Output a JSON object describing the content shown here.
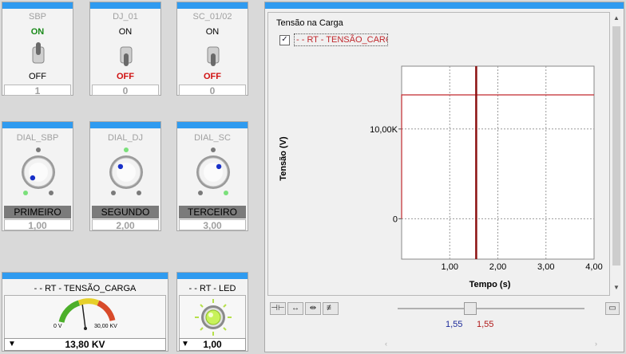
{
  "switches": [
    {
      "title": "SBP",
      "on": "ON",
      "off": "OFF",
      "value": "1",
      "active": "on"
    },
    {
      "title": "DJ_01",
      "on": "ON",
      "off": "OFF",
      "value": "0",
      "active": "off"
    },
    {
      "title": "SC_01/02",
      "on": "ON",
      "off": "OFF",
      "value": "0",
      "active": "off"
    }
  ],
  "dials": [
    {
      "title": "DIAL_SBP",
      "position": "PRIMEIRO",
      "value": "1,00"
    },
    {
      "title": "DIAL_DJ",
      "position": "SEGUNDO",
      "value": "2,00"
    },
    {
      "title": "DIAL_SC",
      "position": "TERCEIRO",
      "value": "3,00"
    }
  ],
  "gauge": {
    "title": "- - RT - TENSÃO_CARGA",
    "min_label": "0 V",
    "max_label": "30,00 KV",
    "value": "13,80 KV",
    "fraction": 0.46
  },
  "led": {
    "title": "- - RT - LED",
    "value": "1,00",
    "color": "#c8f25a"
  },
  "chart_panel": {
    "header": "Tensão na Carga",
    "legend_checked": true,
    "legend_text": "- - RT - TENSÃO_CARG",
    "cursor_a": "1,55",
    "cursor_b": "1,55"
  },
  "chart_data": {
    "type": "line",
    "xlabel": "Tempo (s)",
    "ylabel": "Tensão (V)",
    "x_ticks": [
      "1,00",
      "2,00",
      "3,00",
      "4,00"
    ],
    "y_ticks": [
      "0",
      "10,00K"
    ],
    "xlim": [
      0,
      4
    ],
    "ylim": [
      -4500,
      17000
    ],
    "grid": true,
    "series": [
      {
        "name": "- - RT - TENSÃO_CARGA",
        "color": "#c0282d",
        "x": [
          0,
          0,
          4
        ],
        "y": [
          0,
          13800,
          13800
        ]
      }
    ],
    "cursor_x": 1.55
  },
  "toolbar_icons": [
    "fit-x-icon",
    "zoom-x-icon",
    "pan-x-icon",
    "cursor-icon"
  ],
  "colors": {
    "accent": "#2f9bf0",
    "trace": "#c0282d",
    "cursor": "#8b1010"
  }
}
